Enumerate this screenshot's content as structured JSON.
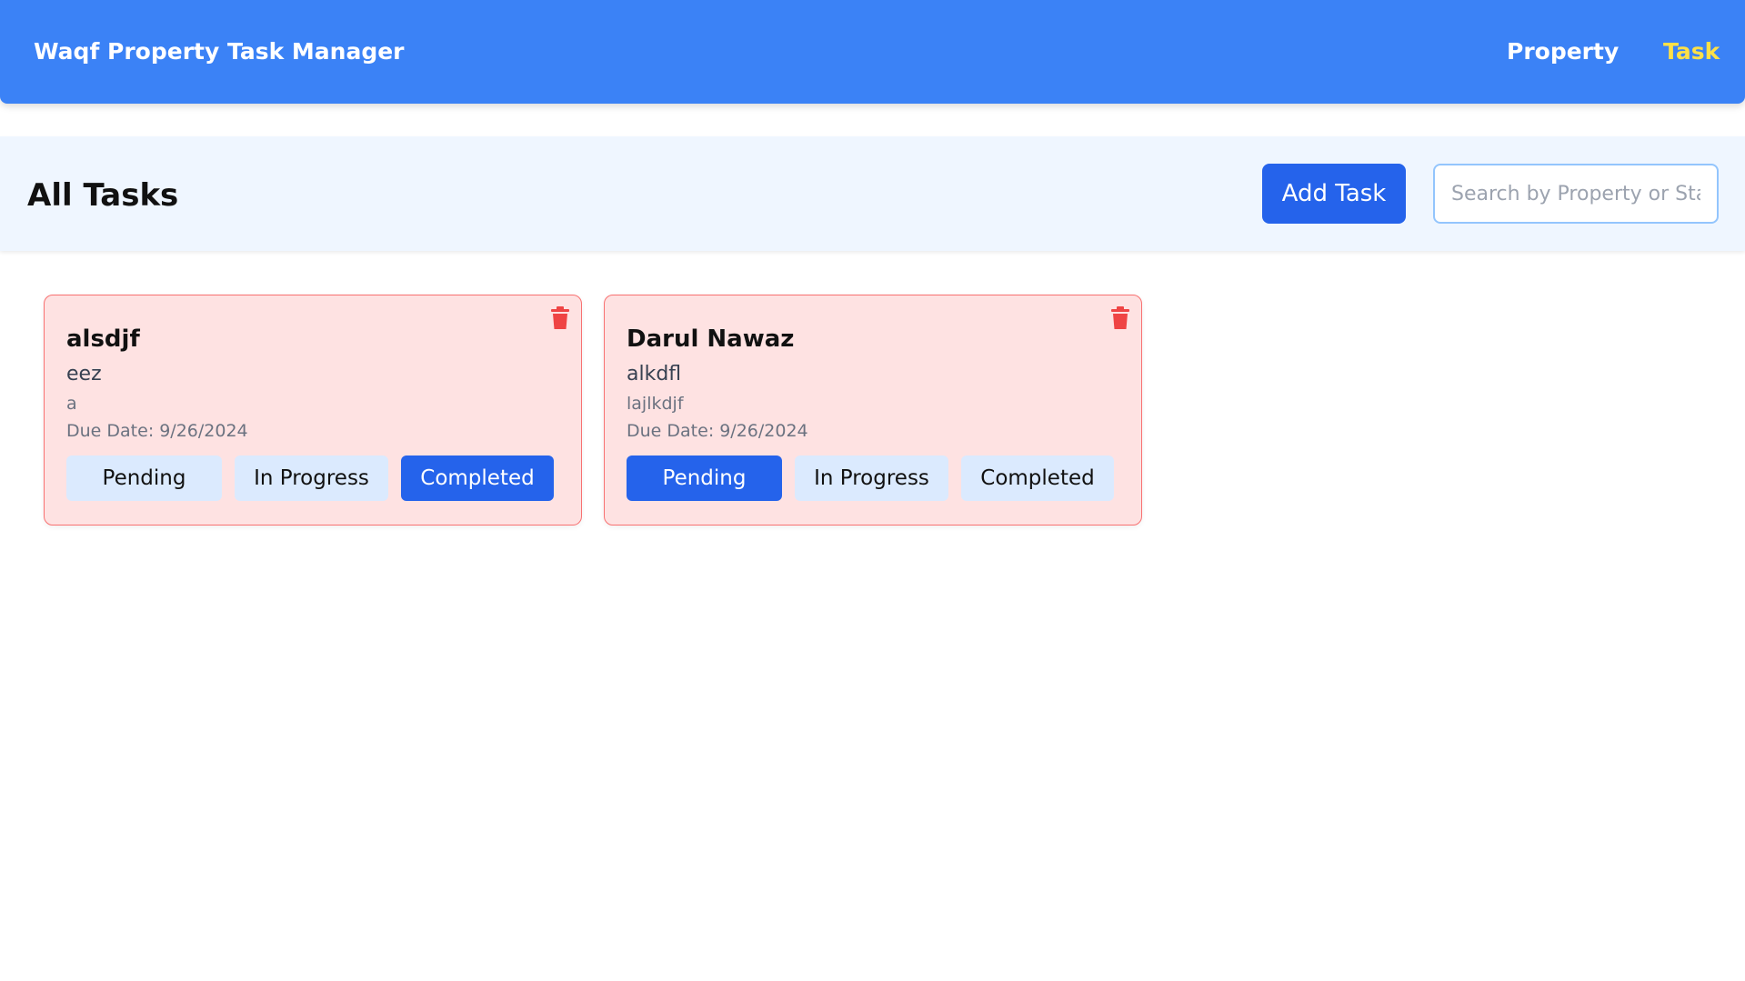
{
  "nav": {
    "brand": "Waqf Property Task Manager",
    "links": [
      {
        "label": "Property",
        "active": false
      },
      {
        "label": "Task",
        "active": true
      }
    ],
    "colors": {
      "bar": "#3b82f6",
      "active_link": "#fde047"
    }
  },
  "header": {
    "title": "All Tasks",
    "add_label": "Add Task",
    "search_placeholder": "Search by Property or Status",
    "search_value": ""
  },
  "statuses": [
    "Pending",
    "In Progress",
    "Completed"
  ],
  "due_label": "Due Date:",
  "tasks": [
    {
      "property": "alsdjf",
      "title": "eez",
      "description": "a",
      "due_date": "9/26/2024",
      "status": "Completed",
      "delete_icon": "trash-icon"
    },
    {
      "property": "Darul Nawaz",
      "title": "alkdfl",
      "description": "lajlkdjf",
      "due_date": "9/26/2024",
      "status": "Pending",
      "delete_icon": "trash-icon"
    }
  ]
}
